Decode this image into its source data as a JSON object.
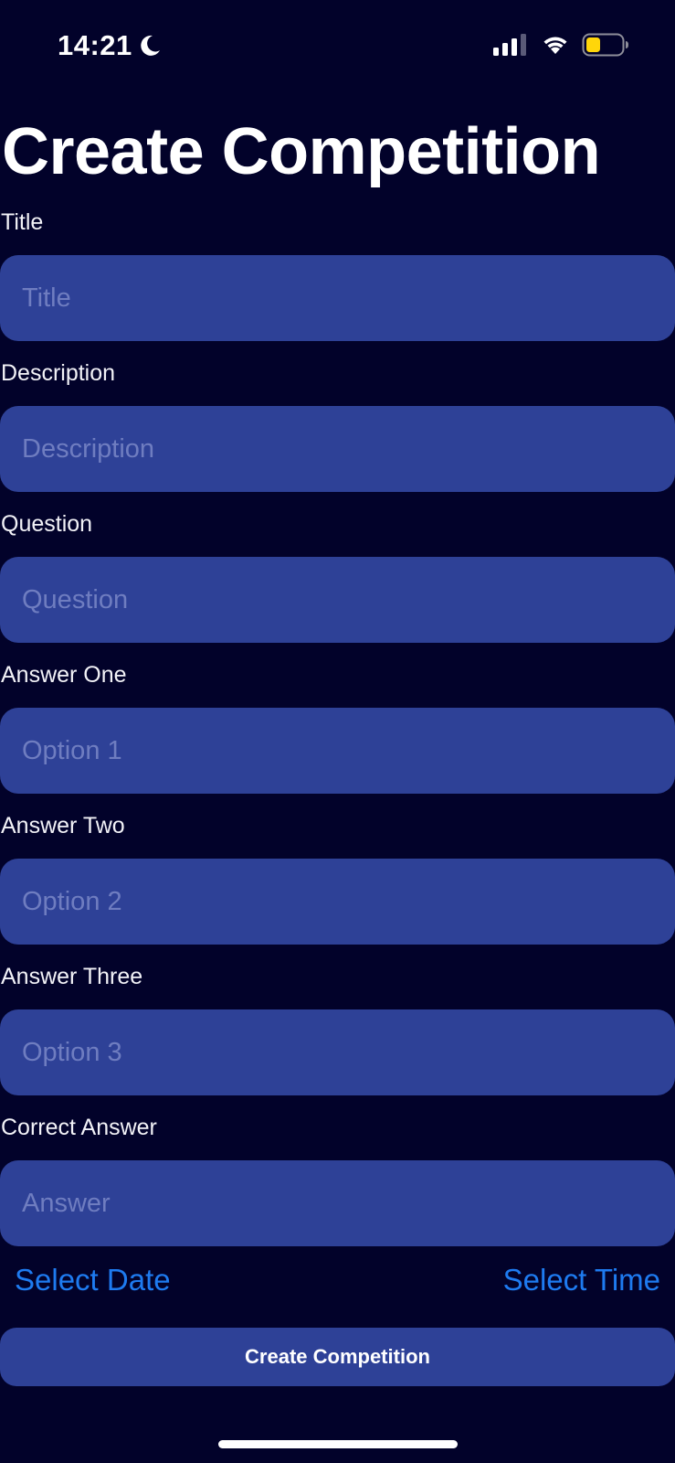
{
  "status_bar": {
    "time": "14:21",
    "icons": [
      "moon-icon",
      "signal-icon",
      "wifi-icon",
      "battery-icon"
    ],
    "battery_color": "#ffd60a"
  },
  "page_title": "Create Competition",
  "fields": [
    {
      "label": "Title",
      "placeholder": "Title",
      "value": ""
    },
    {
      "label": "Description",
      "placeholder": "Description",
      "value": ""
    },
    {
      "label": "Question",
      "placeholder": "Question",
      "value": ""
    },
    {
      "label": "Answer One",
      "placeholder": "Option 1",
      "value": ""
    },
    {
      "label": "Answer Two",
      "placeholder": "Option 2",
      "value": ""
    },
    {
      "label": "Answer Three",
      "placeholder": "Option 3",
      "value": ""
    },
    {
      "label": "Correct Answer",
      "placeholder": "Answer",
      "value": ""
    }
  ],
  "actions": {
    "select_date": "Select Date",
    "select_time": "Select Time",
    "create_button": "Create Competition"
  },
  "colors": {
    "background": "#02022a",
    "field_background": "#2e4197",
    "placeholder_text": "#6f7dc0",
    "link_blue": "#1e7bf0"
  }
}
